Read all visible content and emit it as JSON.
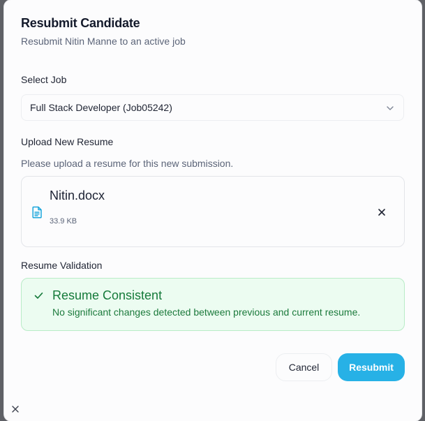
{
  "dialog": {
    "title": "Resubmit Candidate",
    "subtitle": "Resubmit Nitin Manne to an active job"
  },
  "job": {
    "label": "Select Job",
    "selected": "Full Stack Developer (Job05242)",
    "icon": "chevron-down-icon"
  },
  "upload": {
    "label": "Upload New Resume",
    "hint": "Please upload a resume for this new submission.",
    "file": {
      "name": "Nitin.docx",
      "size": "33.9 KB",
      "icon": "document-icon",
      "remove_icon": "close-icon"
    }
  },
  "validation": {
    "label": "Resume Validation",
    "title": "Resume Consistent",
    "message": "No significant changes detected between previous and current resume.",
    "icon": "check-icon",
    "colors": {
      "background": "#ecfcf1",
      "border": "#b9ecc7",
      "text": "#157a3a"
    }
  },
  "actions": {
    "cancel_label": "Cancel",
    "resubmit_label": "Resubmit",
    "accent": "#27b1e6"
  },
  "close_icon": "close-icon"
}
